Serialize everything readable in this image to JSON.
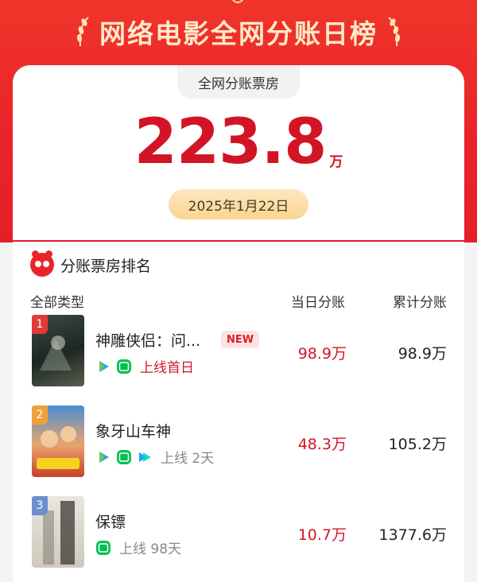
{
  "header": {
    "title": "网络电影全网分账日榜"
  },
  "summary": {
    "label": "全网分账票房",
    "value": "223.8",
    "unit": "万",
    "date": "2025年1月22日"
  },
  "ranking": {
    "title": "分账票房排名",
    "columns": [
      "全部类型",
      "当日分账",
      "累计分账"
    ],
    "rows": [
      {
        "rank": "1",
        "title": "神雕侠侣：问...",
        "tag": "NEW",
        "platforms": [
          "tencent-video-icon",
          "iqiyi-icon"
        ],
        "release": "上线首日",
        "release_color": "#d31425",
        "daily": "98.9万",
        "total": "98.9万",
        "badge_color": "#e13a3a"
      },
      {
        "rank": "2",
        "title": "象牙山车神",
        "tag": "",
        "platforms": [
          "tencent-video-icon",
          "iqiyi-icon",
          "youku-icon"
        ],
        "release": "上线 2天",
        "release_color": "#888888",
        "daily": "48.3万",
        "total": "105.2万",
        "badge_color": "#f0a23a"
      },
      {
        "rank": "3",
        "title": "保镖",
        "tag": "",
        "platforms": [
          "iqiyi-icon"
        ],
        "release": "上线 98天",
        "release_color": "#888888",
        "daily": "10.7万",
        "total": "1377.6万",
        "badge_color": "#6d8fd1"
      }
    ]
  }
}
